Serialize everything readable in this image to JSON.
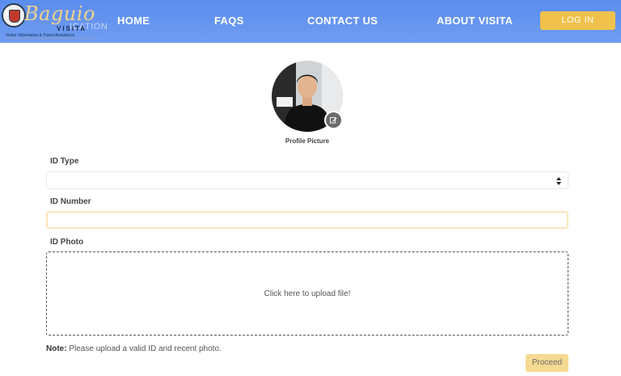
{
  "brand": {
    "script": "Baguio",
    "subtitle": "VISITA",
    "tagline": "Visitor Information & Travel Assistance",
    "ghost_text": "ICATION"
  },
  "nav": {
    "home": "HOME",
    "faqs": "FAQS",
    "contact": "CONTACT US",
    "about": "ABOUT VISITA",
    "login": "LOG IN"
  },
  "colors": {
    "navbar": "#5b8def",
    "accent": "#f0c24b",
    "proceed": "#f6d991",
    "input_focus": "#fae4bd"
  },
  "profile": {
    "label": "Profile Picture",
    "edit_icon": "edit-icon"
  },
  "form": {
    "id_type_label": "ID Type",
    "id_type_value": "",
    "id_number_label": "ID Number",
    "id_number_value": "",
    "id_photo_label": "ID Photo",
    "upload_text": "Click here to upload file!",
    "note_label": "Note:",
    "note_text": " Please upload a valid ID and recent photo.",
    "proceed": "Proceed"
  }
}
